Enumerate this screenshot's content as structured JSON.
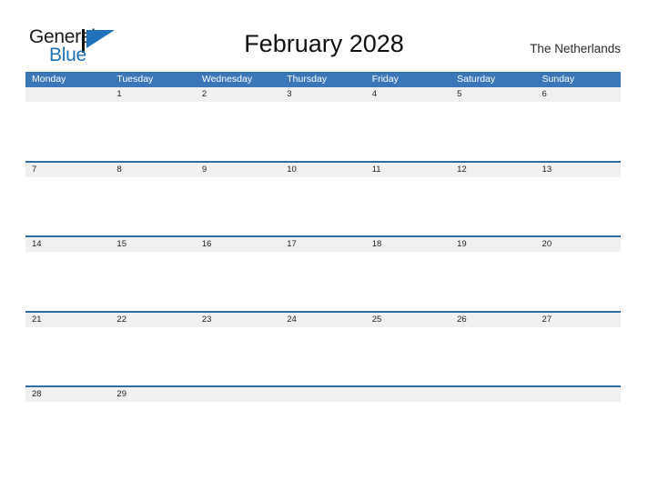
{
  "logo": {
    "word_one": "General",
    "word_two": "Blue",
    "icon": "flag-triangle-icon",
    "color_dark": "#1a1a1a",
    "color_blue": "#2072b8"
  },
  "header": {
    "title": "February 2028",
    "region": "The Netherlands"
  },
  "colors": {
    "header_bar": "#3b77b8",
    "date_band": "#f0f0f0",
    "row_separator": "#2e6da4",
    "background": "#ffffff",
    "text": "#1f1f1f"
  },
  "calendar": {
    "month": "February",
    "year": "2028",
    "weekdays": [
      "Monday",
      "Tuesday",
      "Wednesday",
      "Thursday",
      "Friday",
      "Saturday",
      "Sunday"
    ],
    "weeks": [
      {
        "days": [
          "",
          "1",
          "2",
          "3",
          "4",
          "5",
          "6"
        ]
      },
      {
        "days": [
          "7",
          "8",
          "9",
          "10",
          "11",
          "12",
          "13"
        ]
      },
      {
        "days": [
          "14",
          "15",
          "16",
          "17",
          "18",
          "19",
          "20"
        ]
      },
      {
        "days": [
          "21",
          "22",
          "23",
          "24",
          "25",
          "26",
          "27"
        ]
      },
      {
        "days": [
          "28",
          "29",
          "",
          "",
          "",
          "",
          ""
        ]
      }
    ]
  }
}
